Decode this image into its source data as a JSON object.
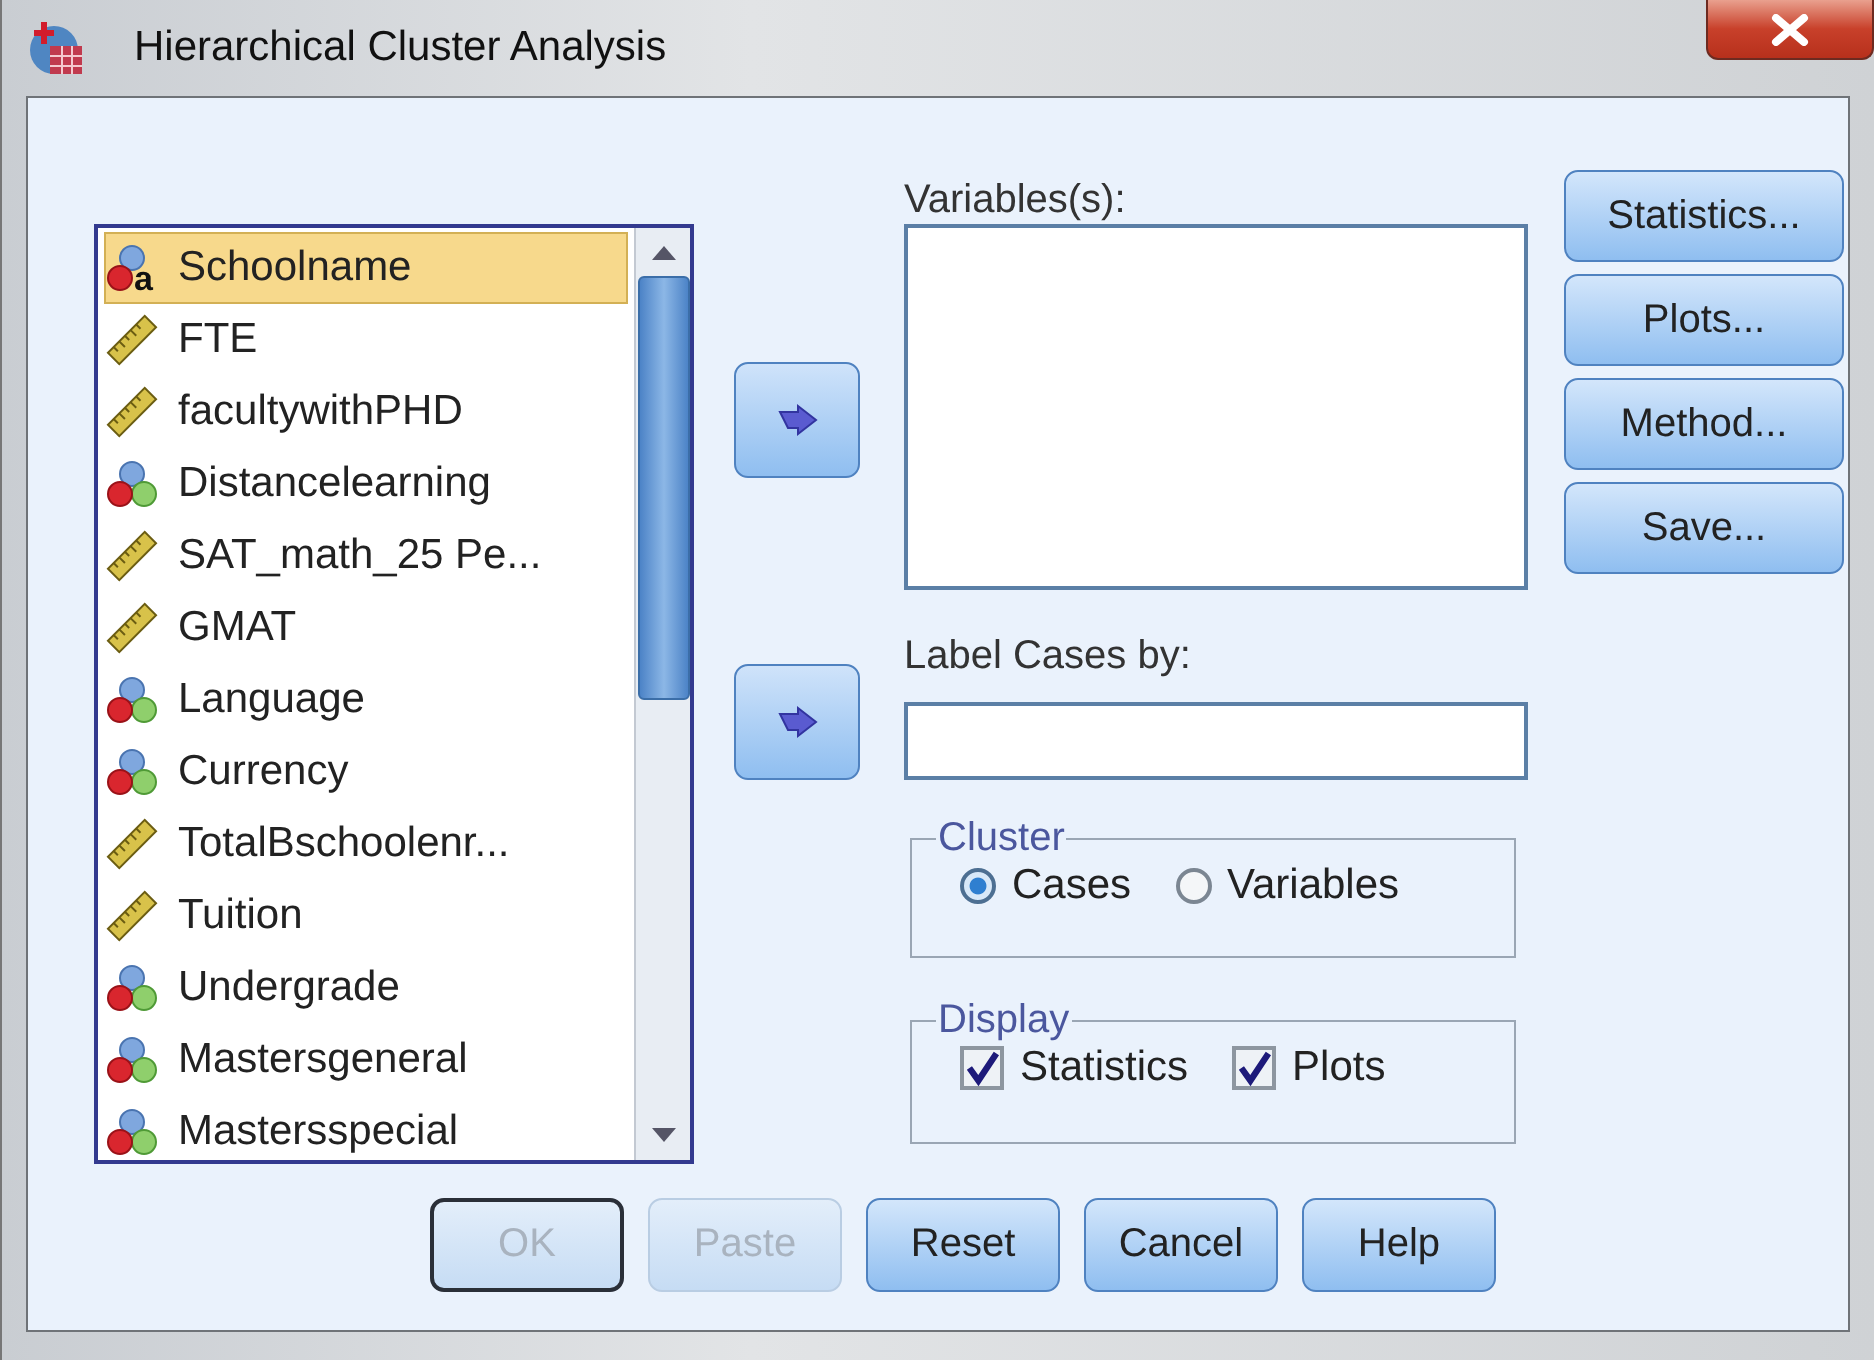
{
  "window": {
    "title": "Hierarchical Cluster Analysis"
  },
  "source_list": {
    "items": [
      {
        "label": "Schoolname",
        "kind": "string",
        "type_letter": "a",
        "selected": true
      },
      {
        "label": "FTE",
        "kind": "scale",
        "selected": false
      },
      {
        "label": "facultywithPHD",
        "kind": "scale",
        "selected": false
      },
      {
        "label": "Distancelearning",
        "kind": "nominal",
        "selected": false
      },
      {
        "label": "SAT_math_25 Pe...",
        "kind": "scale",
        "selected": false
      },
      {
        "label": "GMAT",
        "kind": "scale",
        "selected": false
      },
      {
        "label": "Language",
        "kind": "nominal",
        "selected": false
      },
      {
        "label": "Currency",
        "kind": "nominal",
        "selected": false
      },
      {
        "label": "TotalBschoolenr...",
        "kind": "scale",
        "selected": false
      },
      {
        "label": "Tuition",
        "kind": "scale",
        "selected": false
      },
      {
        "label": "Undergrade",
        "kind": "nominal",
        "selected": false
      },
      {
        "label": "Mastersgeneral",
        "kind": "nominal",
        "selected": false
      },
      {
        "label": "Mastersspecial",
        "kind": "nominal",
        "selected": false
      }
    ]
  },
  "variables": {
    "label": "Variables(s):"
  },
  "label_cases": {
    "label": "Label Cases by:"
  },
  "cluster": {
    "legend": "Cluster",
    "options": [
      {
        "label": "Cases",
        "selected": true
      },
      {
        "label": "Variables",
        "selected": false
      }
    ]
  },
  "display": {
    "legend": "Display",
    "options": [
      {
        "label": "Statistics",
        "checked": true
      },
      {
        "label": "Plots",
        "checked": true
      }
    ]
  },
  "side_buttons": [
    "Statistics...",
    "Plots...",
    "Method...",
    "Save..."
  ],
  "buttons": [
    {
      "label": "OK",
      "disabled": true,
      "focused": true
    },
    {
      "label": "Paste",
      "disabled": true,
      "focused": false
    },
    {
      "label": "Reset",
      "disabled": false,
      "focused": false
    },
    {
      "label": "Cancel",
      "disabled": false,
      "focused": false
    },
    {
      "label": "Help",
      "disabled": false,
      "focused": false
    }
  ]
}
